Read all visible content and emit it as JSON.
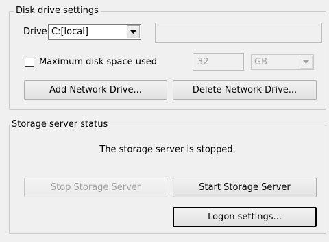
{
  "disk_drive_settings": {
    "legend": "Disk drive settings",
    "drive_label": "Drive",
    "drive_value": "C:[local]",
    "drive_info": "",
    "max_space_label": "Maximum disk space used",
    "max_space_checked": false,
    "max_space_value": "32",
    "max_space_unit": "GB",
    "add_network_drive": "Add Network Drive...",
    "delete_network_drive": "Delete Network Drive..."
  },
  "storage_server_status": {
    "legend": "Storage server status",
    "status_text": "The storage server is stopped.",
    "stop_button": "Stop Storage Server",
    "start_button": "Start Storage Server",
    "logon_button": "Logon settings..."
  },
  "icons": {
    "dropdown_arrow": "chevron-down-icon"
  }
}
